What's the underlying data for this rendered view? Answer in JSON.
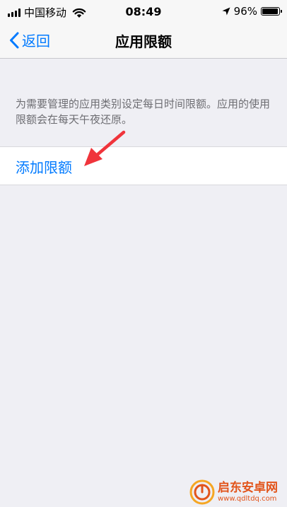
{
  "status_bar": {
    "carrier": "中国移动",
    "time": "08:49",
    "battery_percent": "96%",
    "battery_level": 0.96
  },
  "nav": {
    "back_label": "返回",
    "title": "应用限额"
  },
  "main": {
    "description": "为需要管理的应用类别设定每日时间限额。应用的使用限额会在每天午夜还原。",
    "add_limit_label": "添加限额"
  },
  "watermark": {
    "name": "启东安卓网",
    "url": "www.qdltdq.com"
  },
  "colors": {
    "accent": "#007aff",
    "background": "#efeff4",
    "annotation_arrow": "#f0343b"
  },
  "icons": {
    "signal": "cellular-signal-icon",
    "wifi": "wifi-icon",
    "location": "location-arrow-icon",
    "battery": "battery-icon",
    "back": "chevron-left-icon"
  }
}
